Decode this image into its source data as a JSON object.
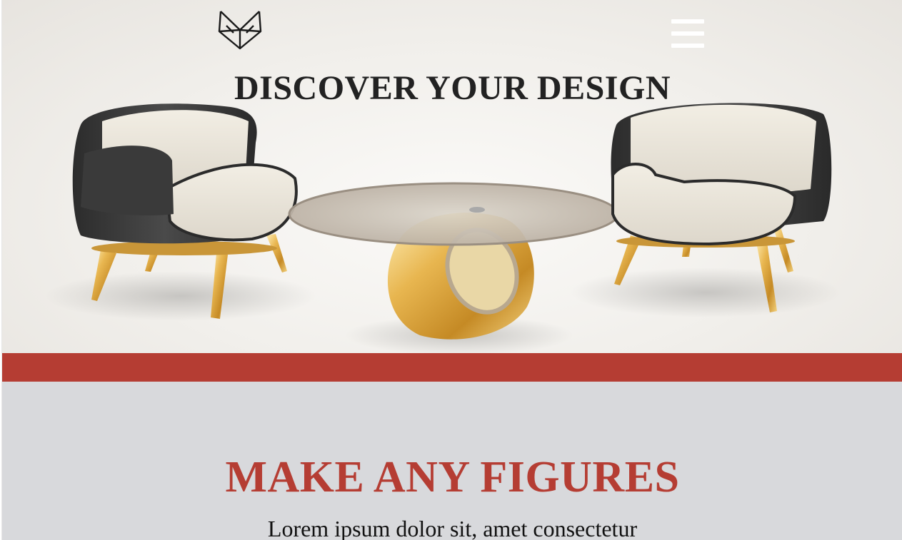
{
  "header": {
    "logo_icon": "fox-geometric-logo-icon",
    "menu_icon": "hamburger-menu-icon"
  },
  "hero": {
    "title": "DISCOVER YOUR DESIGN",
    "image_description": "two-armchairs-and-glass-coffee-table"
  },
  "features": {
    "title": "MAKE ANY FIGURES",
    "text": "Lorem ipsum dolor sit, amet consectetur"
  },
  "colors": {
    "accent": "#b53d33",
    "features_bg": "#d8d9dc",
    "hero_title": "#222222"
  }
}
